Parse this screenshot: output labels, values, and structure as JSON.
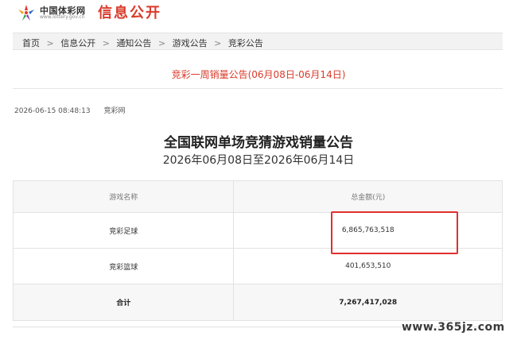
{
  "header": {
    "logo_cn": "中国体彩网",
    "logo_url": "www.lottery.gov.cn",
    "section_title": "信息公开",
    "brand_color": "#d93a2a"
  },
  "breadcrumb": {
    "items": [
      "首页",
      "信息公开",
      "通知公告",
      "游戏公告",
      "竞彩公告"
    ],
    "separator": ">"
  },
  "article": {
    "title": "竞彩一周销量公告(06月08日-06月14日)",
    "timestamp": "2026-06-15 08:48:13",
    "source": "竞彩网"
  },
  "notice": {
    "title": "全国联网单场竞猜游戏销量公告",
    "subtitle": "2026年06月08日至2026年06月14日"
  },
  "table": {
    "headers": [
      "游戏名称",
      "总金额(元)"
    ],
    "rows": [
      {
        "name": "竞彩足球",
        "amount": "6,865,763,518"
      },
      {
        "name": "竞彩篮球",
        "amount": "401,653,510"
      }
    ],
    "total": {
      "name": "合计",
      "amount": "7,267,417,028"
    }
  },
  "annotation": {
    "highlight_color": "#e0302d"
  },
  "watermark": "www.365jz.com"
}
